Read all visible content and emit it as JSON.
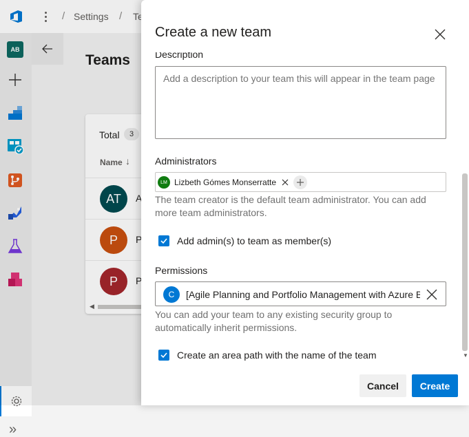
{
  "header": {
    "breadcrumbs": [
      "Settings",
      "Te"
    ]
  },
  "rail": {
    "org_initials": "AB",
    "items": [
      "home-org",
      "add",
      "boards",
      "boards-check",
      "repos",
      "pipelines",
      "test-plans",
      "artifacts",
      "settings",
      "expand"
    ]
  },
  "page": {
    "title": "Teams",
    "total_label": "Total",
    "total_count": "3",
    "column_name": "Name",
    "rows": [
      {
        "initials": "AT",
        "text": "A",
        "color": "#004b50"
      },
      {
        "initials": "P",
        "text": "P",
        "color": "#ca5010"
      },
      {
        "initials": "P",
        "text": "P",
        "color": "#a4262c"
      }
    ]
  },
  "dialog": {
    "title": "Create a new team",
    "description": {
      "label": "Description",
      "placeholder": "Add a description to your team this will appear in the team page"
    },
    "administrators": {
      "label": "Administrators",
      "admin_name": "Lizbeth Gómes Monserratte",
      "admin_initials": "LM",
      "help": "The team creator is the default team administrator. You can add more team administrators."
    },
    "add_admins_checkbox": {
      "label": "Add admin(s) to team as member(s)",
      "checked": true
    },
    "permissions": {
      "label": "Permissions",
      "group_initial": "C",
      "group_name": "[Agile Planning and Portfolio Management with Azure Boards]",
      "help": "You can add your team to any existing security group to automatically inherit permissions."
    },
    "area_path_checkbox": {
      "label": "Create an area path with the name of the team",
      "checked": true
    },
    "cancel_label": "Cancel",
    "create_label": "Create"
  },
  "colors": {
    "accent": "#0078d4",
    "admin_avatar": "#107c10"
  }
}
